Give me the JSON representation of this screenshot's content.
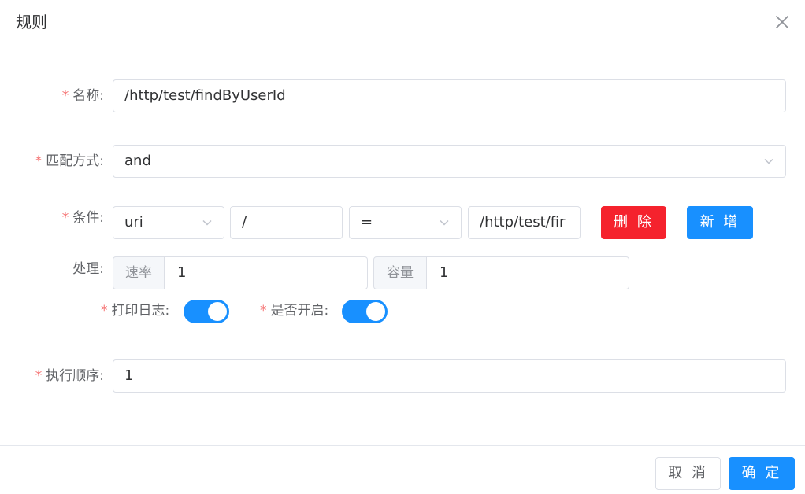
{
  "dialog": {
    "title": "规则",
    "close_icon": "close-icon"
  },
  "required_mark": "*",
  "form": {
    "name": {
      "label": "名称:",
      "value": "/http/test/findByUserId"
    },
    "match_mode": {
      "label": "匹配方式:",
      "value": "and",
      "icon": "chevron-down-icon"
    },
    "condition": {
      "label": "条件:",
      "param_type": "uri",
      "param_name": "/",
      "operator": "=",
      "param_value": "/http/test/fir",
      "delete_label": "删 除",
      "add_label": "新 增"
    },
    "handle": {
      "label": "处理:",
      "rate_label": "速率",
      "rate_value": "1",
      "capacity_label": "容量",
      "capacity_value": "1"
    },
    "logging": {
      "label": "打印日志:",
      "enabled": true
    },
    "enabled": {
      "label": "是否开启:",
      "enabled": true
    },
    "sort": {
      "label": "执行顺序:",
      "value": "1"
    }
  },
  "footer": {
    "cancel_label": "取 消",
    "confirm_label": "确 定"
  },
  "colors": {
    "primary": "#1890ff",
    "danger": "#f5222d",
    "required": "#f56c6c",
    "border": "#dcdfe6"
  }
}
